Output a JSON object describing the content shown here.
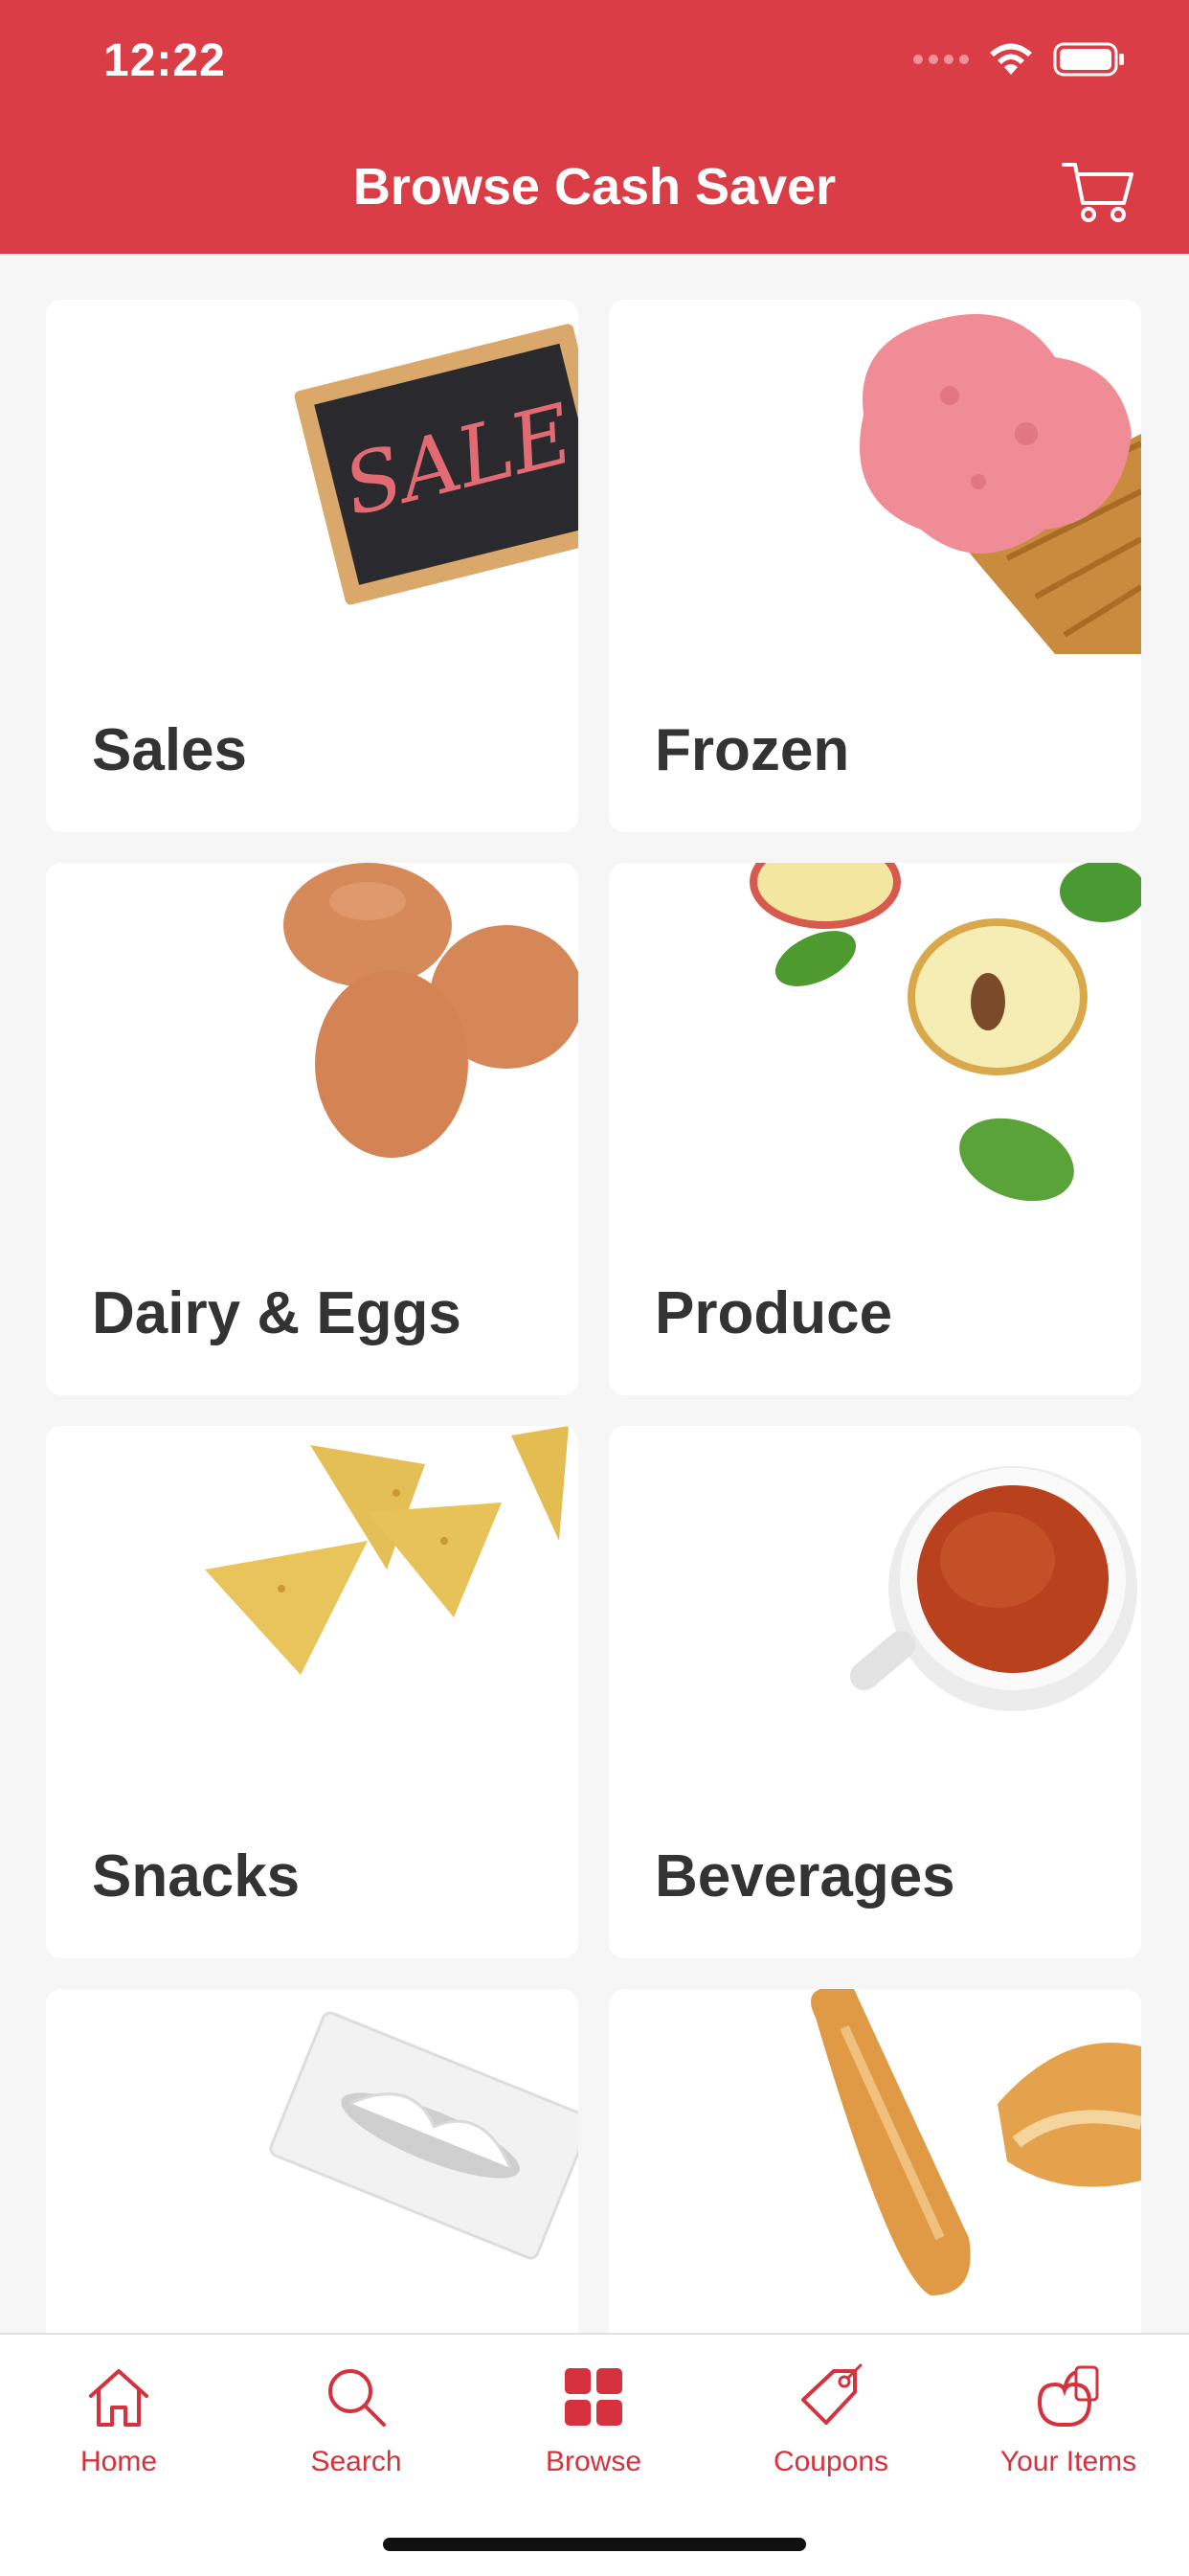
{
  "status_bar": {
    "time": "12:22"
  },
  "header": {
    "title": "Browse Cash Saver"
  },
  "categories": [
    {
      "label": "Sales"
    },
    {
      "label": "Frozen"
    },
    {
      "label": "Dairy & Eggs"
    },
    {
      "label": "Produce"
    },
    {
      "label": "Snacks"
    },
    {
      "label": "Beverages"
    },
    {
      "label": ""
    },
    {
      "label": ""
    }
  ],
  "tabs": [
    {
      "label": "Home",
      "icon": "home-icon"
    },
    {
      "label": "Search",
      "icon": "search-icon"
    },
    {
      "label": "Browse",
      "icon": "grid-icon"
    },
    {
      "label": "Coupons",
      "icon": "tag-icon"
    },
    {
      "label": "Your Items",
      "icon": "basket-icon"
    }
  ],
  "colors": {
    "brand": "#db3d47",
    "tab_active": "#d6323d",
    "background": "#f6f6f6"
  }
}
